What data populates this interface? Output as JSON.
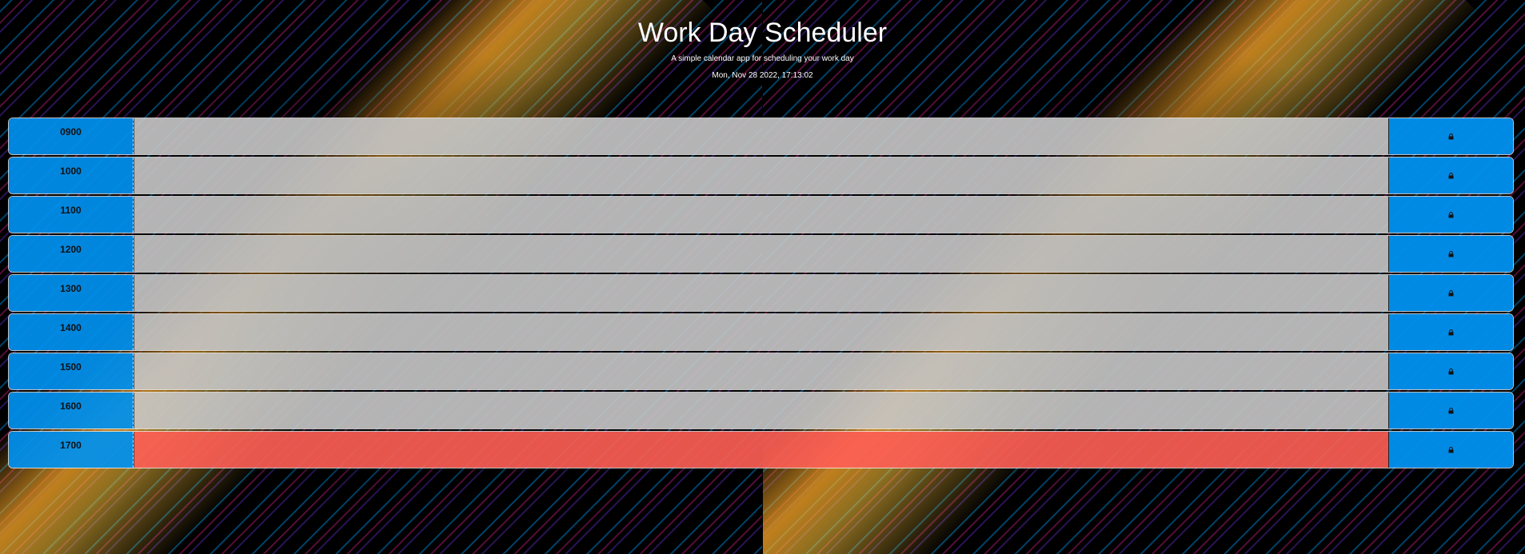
{
  "header": {
    "title": "Work Day Scheduler",
    "subtitle": "A simple calendar app for scheduling your work day",
    "current_date": "Mon, Nov 28 2022, 17:13:02"
  },
  "colors": {
    "hour_block": "#0091f0",
    "past": "#c8c8c8",
    "present": "#ff5f55"
  },
  "rows": [
    {
      "hour": "0900",
      "description": "",
      "state": "past",
      "save_icon": "lock-icon"
    },
    {
      "hour": "1000",
      "description": "",
      "state": "past",
      "save_icon": "lock-icon"
    },
    {
      "hour": "1100",
      "description": "",
      "state": "past",
      "save_icon": "lock-icon"
    },
    {
      "hour": "1200",
      "description": "",
      "state": "past",
      "save_icon": "lock-icon"
    },
    {
      "hour": "1300",
      "description": "",
      "state": "past",
      "save_icon": "lock-icon"
    },
    {
      "hour": "1400",
      "description": "",
      "state": "past",
      "save_icon": "lock-icon"
    },
    {
      "hour": "1500",
      "description": "",
      "state": "past",
      "save_icon": "lock-icon"
    },
    {
      "hour": "1600",
      "description": "",
      "state": "past",
      "save_icon": "lock-icon"
    },
    {
      "hour": "1700",
      "description": "",
      "state": "present",
      "save_icon": "lock-icon"
    }
  ]
}
